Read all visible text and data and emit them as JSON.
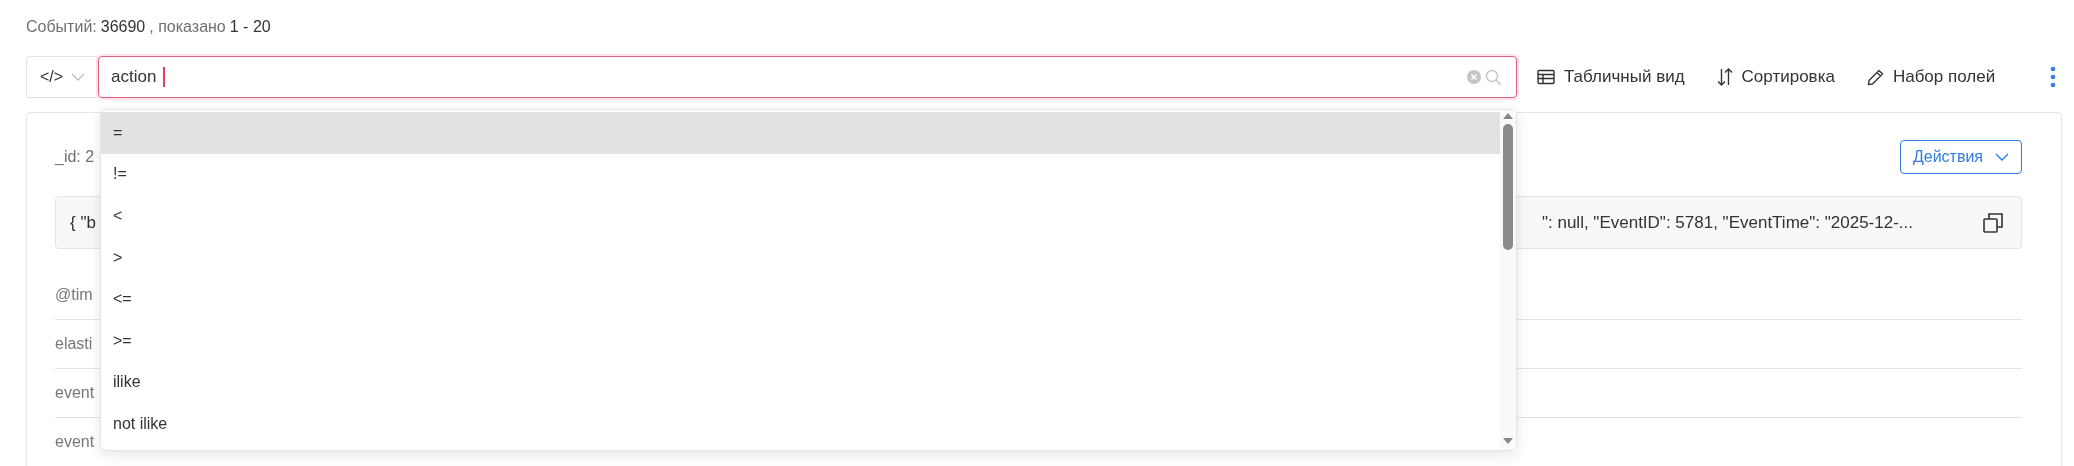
{
  "summary": {
    "events_label": "Событий:",
    "events": "36690",
    "shown_label": ", показано",
    "range": "1 - 20"
  },
  "query_mode": {
    "label": "</>"
  },
  "search": {
    "value": "action"
  },
  "toolbar": [
    {
      "label": "Табличный вид",
      "kind": "table"
    },
    {
      "label": "Сортировка",
      "kind": "sort"
    },
    {
      "label": "Набор полей",
      "kind": "fields"
    }
  ],
  "record": {
    "id": "_id: 2",
    "actions": "Действия",
    "json_start": "{ \"b",
    "json_end": "\": null, \"EventID\": 5781, \"EventTime\": \"2025-12-...",
    "fields": [
      "@tim",
      "elasti",
      "event",
      "event"
    ]
  },
  "suggestions": [
    {
      "label": "=",
      "selected": true
    },
    {
      "label": "!=",
      "selected": false
    },
    {
      "label": "<",
      "selected": false
    },
    {
      "label": ">",
      "selected": false
    },
    {
      "label": "<=",
      "selected": false
    },
    {
      "label": ">=",
      "selected": false
    },
    {
      "label": "ilike",
      "selected": false
    },
    {
      "label": "not ilike",
      "selected": false
    }
  ]
}
